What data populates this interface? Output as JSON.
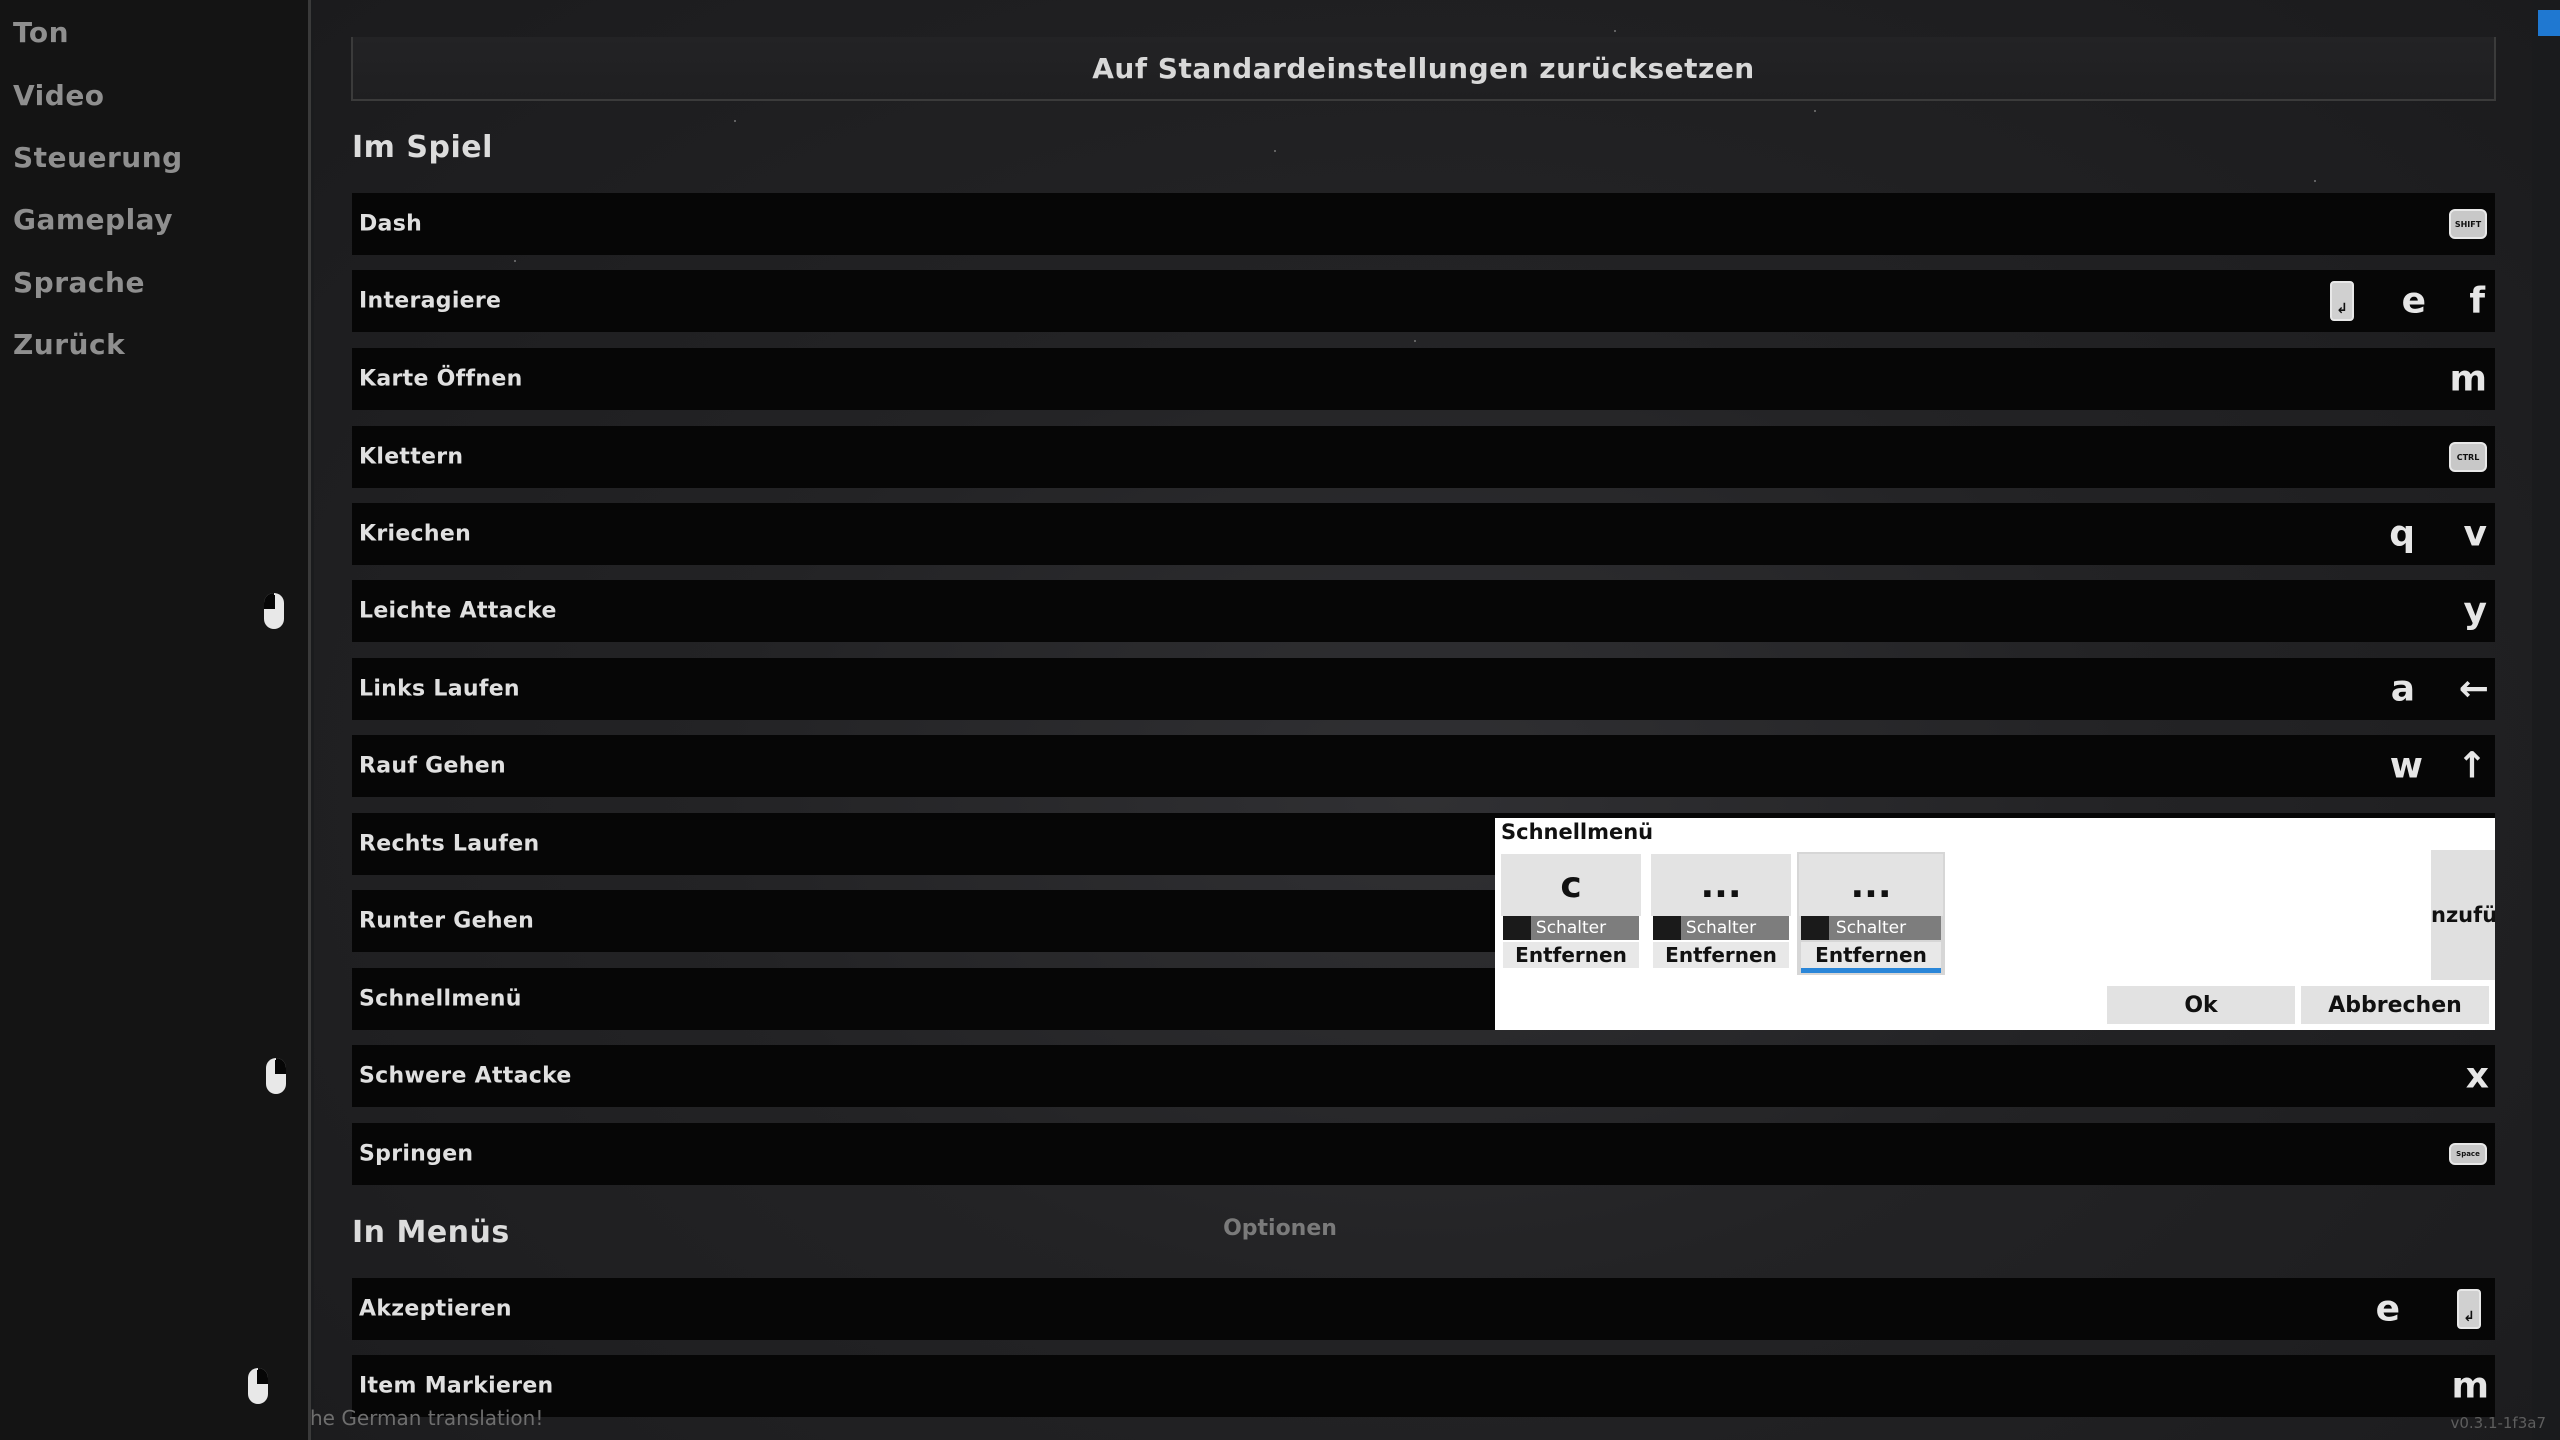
{
  "sidebar": {
    "items": [
      "Ton",
      "Video",
      "Steuerung",
      "Gameplay",
      "Sprache",
      "Zurück"
    ]
  },
  "reset_button": "Auf Standardeinstellungen zurücksetzen",
  "sections": {
    "ingame": "Im Spiel",
    "menus": "In Menüs"
  },
  "bindings": [
    {
      "label": "Dash",
      "keys": [
        {
          "type": "keyboard-icon",
          "text": "SHIFT"
        }
      ]
    },
    {
      "label": "Interagiere",
      "keys": [
        {
          "type": "enter-key-icon",
          "text": "↲"
        },
        {
          "type": "letter",
          "text": "e"
        },
        {
          "type": "letter",
          "text": "f"
        }
      ]
    },
    {
      "label": "Karte Öffnen",
      "keys": [
        {
          "type": "letter",
          "text": "m"
        }
      ]
    },
    {
      "label": "Klettern",
      "keys": [
        {
          "type": "keyboard-icon",
          "text": "CTRL"
        }
      ]
    },
    {
      "label": "Kriechen",
      "keys": [
        {
          "type": "letter",
          "text": "q"
        },
        {
          "type": "letter",
          "text": "v"
        }
      ]
    },
    {
      "label": "Leichte Attacke",
      "keys": [
        {
          "type": "mouse-left-icon"
        },
        {
          "type": "letter",
          "text": "y"
        }
      ]
    },
    {
      "label": "Links Laufen",
      "keys": [
        {
          "type": "letter",
          "text": "a"
        },
        {
          "type": "letter",
          "text": "←"
        }
      ]
    },
    {
      "label": "Rauf Gehen",
      "keys": [
        {
          "type": "letter",
          "text": "w"
        },
        {
          "type": "letter",
          "text": "↑"
        }
      ]
    },
    {
      "label": "Rechts Laufen",
      "keys": []
    },
    {
      "label": "Runter Gehen",
      "keys": []
    },
    {
      "label": "Schnellmenü",
      "keys": []
    },
    {
      "label": "Schwere Attacke",
      "keys": [
        {
          "type": "mouse-right-icon"
        },
        {
          "type": "letter",
          "text": "x"
        }
      ]
    },
    {
      "label": "Springen",
      "keys": [
        {
          "type": "keyboard-icon",
          "text": "Space"
        }
      ]
    },
    {
      "label": "Akzeptieren",
      "keys": [
        {
          "type": "letter",
          "text": "e"
        },
        {
          "type": "enter-key-icon",
          "text": "↲"
        }
      ]
    },
    {
      "label": "Item Markieren",
      "keys": [
        {
          "type": "mouse-right-icon"
        },
        {
          "type": "letter",
          "text": "m"
        }
      ]
    }
  ],
  "background_menu": {
    "options": "Optionen"
  },
  "dialog": {
    "title": "Schnellmenü",
    "slots": [
      {
        "key": "c",
        "switch": "Schalter",
        "remove": "Entfernen"
      },
      {
        "key": "...",
        "switch": "Schalter",
        "remove": "Entfernen"
      },
      {
        "key": "...",
        "switch": "Schalter",
        "remove": "Entfernen"
      }
    ],
    "add_partial": "nzufüg",
    "ok": "Ok",
    "cancel": "Abbrechen"
  },
  "footer": {
    "credit_partial": "he German translation!",
    "version": "v0.3.1-1f3a7"
  },
  "colors": {
    "accent": "#2a86d8",
    "row_bg": "#060606",
    "sidebar_bg": "#141414"
  }
}
